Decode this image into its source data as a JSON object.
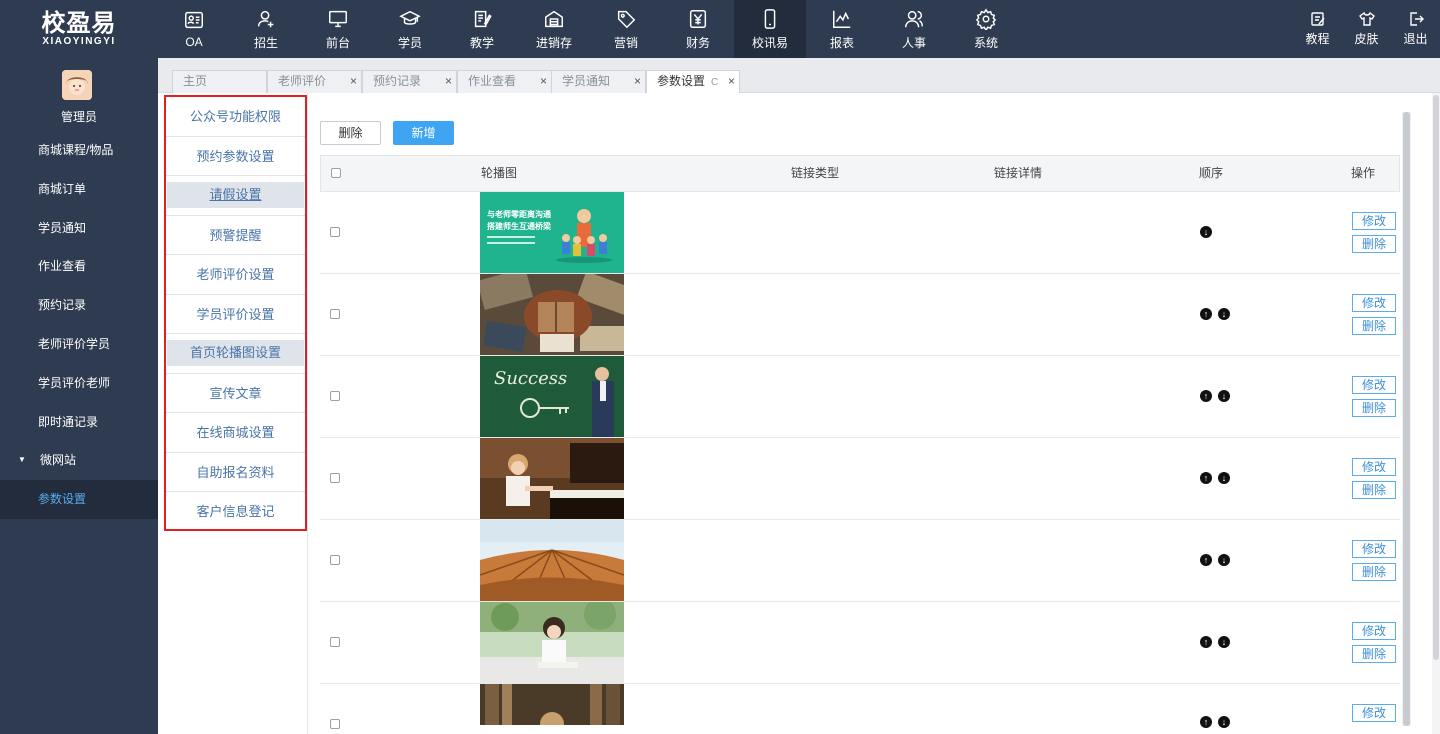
{
  "app": {
    "logo_cn": "校盈易",
    "logo_en": "XIAOYINGYI"
  },
  "topnav": [
    {
      "label": "OA",
      "icon": "id-card-icon"
    },
    {
      "label": "招生",
      "icon": "user-add-icon"
    },
    {
      "label": "前台",
      "icon": "monitor-icon"
    },
    {
      "label": "学员",
      "icon": "graduation-cap-icon"
    },
    {
      "label": "教学",
      "icon": "edit-book-icon"
    },
    {
      "label": "进销存",
      "icon": "warehouse-icon"
    },
    {
      "label": "营销",
      "icon": "tag-icon"
    },
    {
      "label": "财务",
      "icon": "yuan-icon"
    },
    {
      "label": "校讯易",
      "icon": "phone-icon",
      "active": true
    },
    {
      "label": "报表",
      "icon": "chart-icon"
    },
    {
      "label": "人事",
      "icon": "people-icon"
    },
    {
      "label": "系统",
      "icon": "gear-icon"
    }
  ],
  "topright": [
    {
      "label": "教程",
      "icon": "edit-icon"
    },
    {
      "label": "皮肤",
      "icon": "shirt-icon"
    },
    {
      "label": "退出",
      "icon": "logout-icon"
    }
  ],
  "sidebar": {
    "user": "管理员",
    "items": [
      "商城课程/物品",
      "商城订单",
      "学员通知",
      "作业查看",
      "预约记录",
      "老师评价学员",
      "学员评价老师",
      "即时通记录",
      "微网站",
      "参数设置"
    ]
  },
  "tabs": [
    "主页",
    "老师评价",
    "预约记录",
    "作业查看",
    "学员通知",
    "参数设置"
  ],
  "settings_menu": [
    "公众号功能权限",
    "预约参数设置",
    "请假设置",
    "预警提醒",
    "老师评价设置",
    "学员评价设置",
    "首页轮播图设置",
    "宣传文章",
    "在线商城设置",
    "自助报名资料",
    "客户信息登记"
  ],
  "toolbar": {
    "delete": "删除",
    "add": "新增"
  },
  "table": {
    "columns": [
      "轮播图",
      "链接类型",
      "链接详情",
      "顺序",
      "操作"
    ],
    "row_actions": {
      "edit": "修改",
      "delete": "删除"
    },
    "banner1_text": [
      "与老师零距离沟通",
      "搭建师生互通桥梁"
    ],
    "banner3_text": "Success",
    "rows": [
      {
        "image": "teacher-students-illustration",
        "order": [
          "down"
        ]
      },
      {
        "image": "books-reading-photo",
        "order": [
          "up",
          "down"
        ]
      },
      {
        "image": "success-chalkboard-photo",
        "order": [
          "up",
          "down"
        ]
      },
      {
        "image": "girl-piano-photo",
        "order": [
          "up",
          "down"
        ]
      },
      {
        "image": "open-book-photo",
        "order": [
          "up",
          "down"
        ]
      },
      {
        "image": "girl-studying-photo",
        "order": [
          "up",
          "down"
        ]
      },
      {
        "image": "library-photo",
        "order": [
          "up",
          "down"
        ]
      }
    ]
  },
  "colors": {
    "nav_bg": "#2f3b50",
    "nav_active": "#222c3c",
    "accent": "#3fa5f3",
    "highlight_border": "#e02020"
  }
}
